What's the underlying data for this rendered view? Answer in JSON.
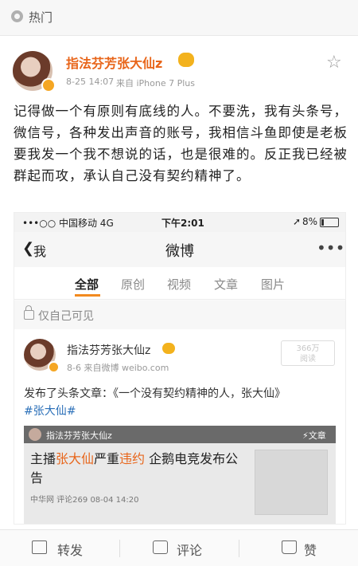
{
  "hotbar": {
    "label": "热门"
  },
  "post": {
    "author": "指法芬芳张大仙z",
    "time": "8-25 14:07",
    "source": "来自 iPhone 7 Plus",
    "text": "记得做一个有原则有底线的人。不要洗，我有头条号，微信号，各种发出声音的账号，我相信斗鱼即使是老板要我发一个我不想说的话，也是很难的。反正我已经被群起而攻，承认自己没有契约精神了。"
  },
  "screenshot": {
    "status": {
      "carrier": "•••○○ 中国移动  4G",
      "time": "下午2:01",
      "battery": "8%"
    },
    "nav": {
      "back_label": "我",
      "title": "微博",
      "more": "•••"
    },
    "tabs": [
      {
        "label": "全部"
      },
      {
        "label": "原创"
      },
      {
        "label": "视频"
      },
      {
        "label": "文章"
      },
      {
        "label": "图片"
      }
    ],
    "privacy_label": "仅自己可见",
    "card": {
      "author": "指法芬芳张大仙z",
      "meta": "8-6  来自微博 weibo.com",
      "reads_count": "366万",
      "reads_label": "阅读",
      "text_prefix": "发布了头条文章：《一个没有契约精神的人，张大仙》",
      "hashtag": "#张大仙#",
      "article": {
        "bar_name": "指法芬芳张大仙z",
        "bar_tag": "⚡文章",
        "title_part1": "主播",
        "title_highlight1": "张大仙",
        "title_part2": "严重",
        "title_highlight2": "违约",
        "title_part3": " 企鹅电竞发布公告",
        "meta": "中华网  评论269  08-04 14:20"
      }
    }
  },
  "actions": {
    "repost": "转发",
    "comment": "评论",
    "like": "赞"
  }
}
